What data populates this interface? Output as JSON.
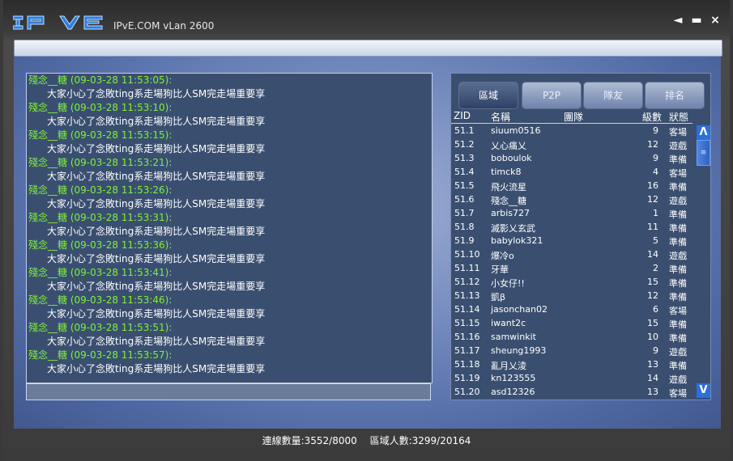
{
  "app": {
    "logo_text": "IPVE",
    "title": "IPvE.COM vLan 2600",
    "controls": {
      "back": "◄",
      "minimize": "▬",
      "close": "×"
    }
  },
  "chat": {
    "messages": [
      {
        "header": "殘念__糖 (09-03-28 11:53:05):",
        "text": "大家小心了念敗ting系走場狗比人SM完走場重要享"
      },
      {
        "header": "殘念__糖 (09-03-28 11:53:10):",
        "text": "大家小心了念敗ting系走場狗比人SM完走場重要享"
      },
      {
        "header": "殘念__糖 (09-03-28 11:53:15):",
        "text": "大家小心了念敗ting系走場狗比人SM完走場重要享"
      },
      {
        "header": "殘念__糖 (09-03-28 11:53:21):",
        "text": "大家小心了念敗ting系走場狗比人SM完走場重要享"
      },
      {
        "header": "殘念__糖 (09-03-28 11:53:26):",
        "text": "大家小心了念敗ting系走場狗比人SM完走場重要享"
      },
      {
        "header": "殘念__糖 (09-03-28 11:53:31):",
        "text": "大家小心了念敗ting系走場狗比人SM完走場重要享"
      },
      {
        "header": "殘念__糖 (09-03-28 11:53:36):",
        "text": "大家小心了念敗ting系走場狗比人SM完走場重要享"
      },
      {
        "header": "殘念__糖 (09-03-28 11:53:41):",
        "text": "大家小心了念敗ting系走場狗比人SM完走場重要享"
      },
      {
        "header": "殘念__糖 (09-03-28 11:53:46):",
        "text": "大家小心了念敗ting系走場狗比人SM完走場重要享"
      },
      {
        "header": "殘念__糖 (09-03-28 11:53:51):",
        "text": "大家小心了念敗ting系走場狗比人SM完走場重要享"
      },
      {
        "header": "殘念__糖 (09-03-28 11:53:57):",
        "text": "大家小心了念敗ting系走場狗比人SM完走場重要享"
      }
    ],
    "input_value": ""
  },
  "tabs": [
    {
      "label": "區域",
      "active": true
    },
    {
      "label": "P2P",
      "active": false
    },
    {
      "label": "隊友",
      "active": false
    },
    {
      "label": "排名",
      "active": false
    }
  ],
  "list": {
    "headers": {
      "zid": "ZID",
      "name": "名稱",
      "clan": "團隊",
      "level": "級數",
      "status": "狀態"
    },
    "rows": [
      {
        "zid": "51.1",
        "name": "siuum0516",
        "level": "9",
        "status": "客場"
      },
      {
        "zid": "51.2",
        "name": "乂心痛乂",
        "level": "12",
        "status": "遊戲"
      },
      {
        "zid": "51.3",
        "name": "boboulok",
        "level": "9",
        "status": "準備"
      },
      {
        "zid": "51.4",
        "name": "timck8",
        "level": "4",
        "status": "客場"
      },
      {
        "zid": "51.5",
        "name": "飛火流星",
        "level": "16",
        "status": "準備"
      },
      {
        "zid": "51.6",
        "name": "殘念__糖",
        "level": "12",
        "status": "遊戲"
      },
      {
        "zid": "51.7",
        "name": "arbis727",
        "level": "1",
        "status": "準備"
      },
      {
        "zid": "51.8",
        "name": "滅影乂玄武",
        "level": "11",
        "status": "準備"
      },
      {
        "zid": "51.9",
        "name": "babylok321",
        "level": "5",
        "status": "準備"
      },
      {
        "zid": "51.10",
        "name": "爆冷o",
        "level": "14",
        "status": "遊戲"
      },
      {
        "zid": "51.11",
        "name": "牙華",
        "level": "2",
        "status": "準備"
      },
      {
        "zid": "51.12",
        "name": "小女仔!!",
        "level": "15",
        "status": "準備"
      },
      {
        "zid": "51.13",
        "name": "凱β",
        "level": "12",
        "status": "準備"
      },
      {
        "zid": "51.14",
        "name": "jasonchan02",
        "level": "6",
        "status": "客場"
      },
      {
        "zid": "51.15",
        "name": "iwant2c",
        "level": "15",
        "status": "準備"
      },
      {
        "zid": "51.16",
        "name": "samwinkit",
        "level": "10",
        "status": "準備"
      },
      {
        "zid": "51.17",
        "name": "sheung1993",
        "level": "9",
        "status": "遊戲"
      },
      {
        "zid": "51.18",
        "name": "亂月乂淩",
        "level": "13",
        "status": "準備"
      },
      {
        "zid": "51.19",
        "name": "kn123555",
        "level": "14",
        "status": "遊戲"
      },
      {
        "zid": "51.20",
        "name": "asd12326",
        "level": "13",
        "status": "客場"
      }
    ],
    "scroll_up": "Λ",
    "scroll_down": "V",
    "scroll_thumb_grip": "≡"
  },
  "status": {
    "connections": "連線數量:3552/8000",
    "region_users": "區域人數:3299/20164"
  },
  "colors": {
    "chat_header": "#7ef03a",
    "panel_bg": "#3a4f70",
    "scrollbar": "#2f6fd6"
  }
}
